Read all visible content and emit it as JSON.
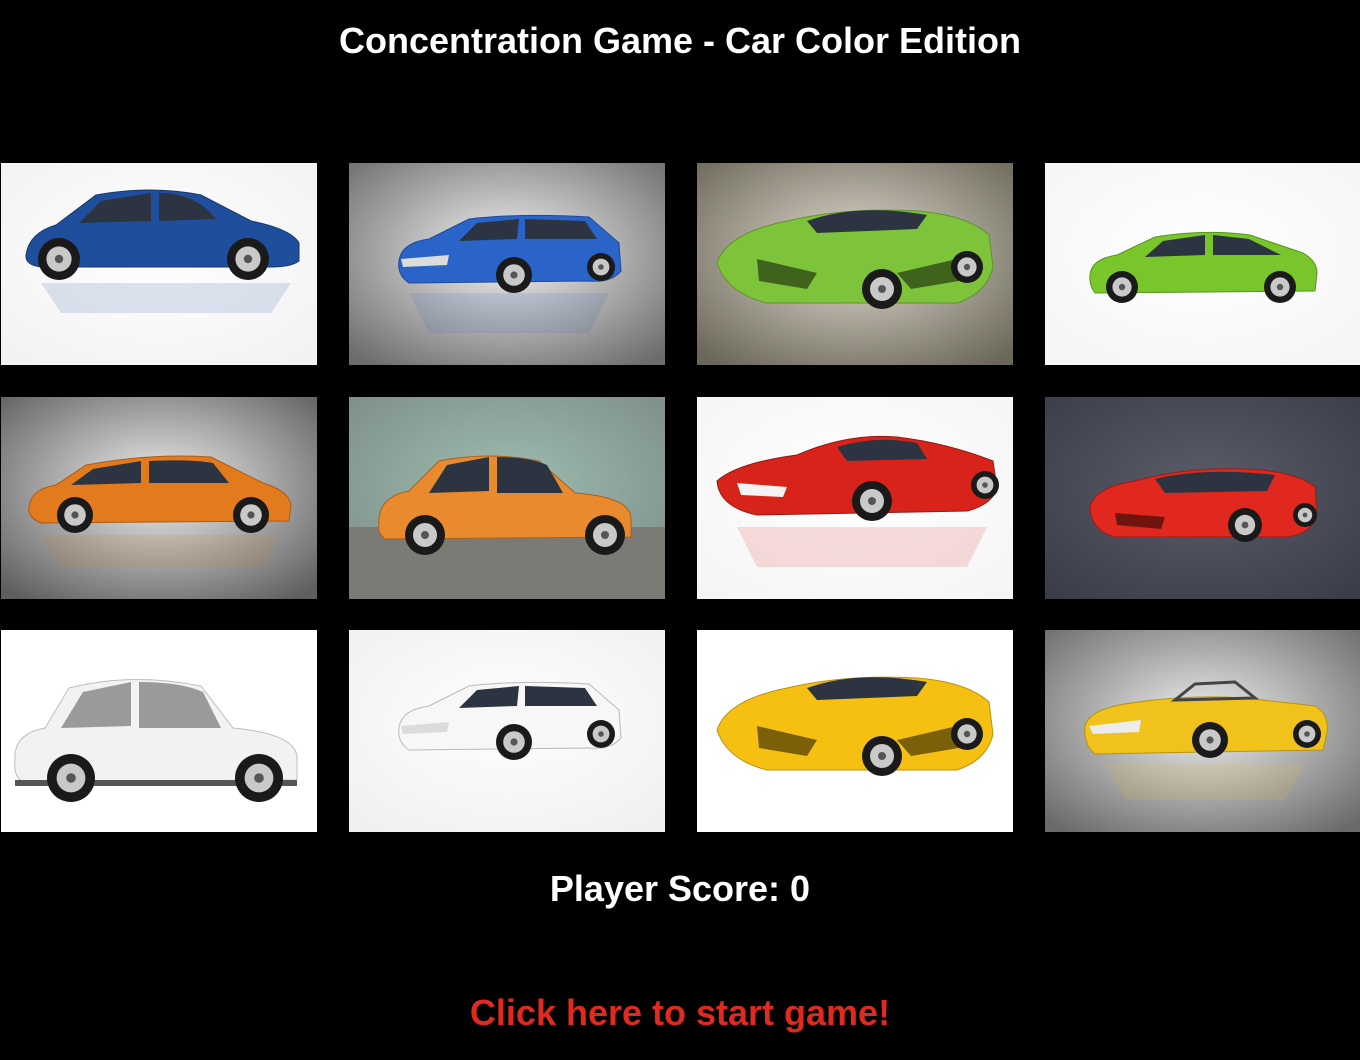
{
  "title": "Concentration Game - Car Color Edition",
  "score": {
    "label": "Player Score: ",
    "value": "0"
  },
  "start_link": "Click here to start game!",
  "colors": {
    "background": "#000000",
    "text": "#ffffff",
    "start_link": "#e0291f"
  },
  "cards": [
    {
      "name": "blue-hatchback",
      "car_color": "#1f4f9c",
      "bg": "#ffffff",
      "bg_edge": "#f2f2f2",
      "body": "hatch"
    },
    {
      "name": "blue-wagon",
      "car_color": "#2a64c8",
      "bg": "#f4f4f4",
      "bg_edge": "#6c6c6c",
      "body": "wagon"
    },
    {
      "name": "green-supercar",
      "car_color": "#7ec43a",
      "bg": "#e2ddd0",
      "bg_edge": "#6a6658",
      "body": "super"
    },
    {
      "name": "green-hybrid",
      "car_color": "#78c52c",
      "bg": "#ffffff",
      "bg_edge": "#f5f5f5",
      "body": "hybrid"
    },
    {
      "name": "orange-wagon",
      "car_color": "#e27a1e",
      "bg": "#f0f0f0",
      "bg_edge": "#5e5e5e",
      "body": "wagon2"
    },
    {
      "name": "orange-compact",
      "car_color": "#e98a2e",
      "bg": "#9fbdb2",
      "bg_edge": "#7d8e86",
      "body": "compact"
    },
    {
      "name": "red-sportscar",
      "car_color": "#d8231b",
      "bg": "#ffffff",
      "bg_edge": "#f5f5f5",
      "body": "sport"
    },
    {
      "name": "red-supercar",
      "car_color": "#e0281e",
      "bg": "#5a5d6a",
      "bg_edge": "#3b3d48",
      "body": "super2"
    },
    {
      "name": "white-compact",
      "car_color": "#f2f2f2",
      "bg": "#ffffff",
      "bg_edge": "#ffffff",
      "body": "compact2"
    },
    {
      "name": "white-wagon",
      "car_color": "#f7f7f7",
      "bg": "#ffffff",
      "bg_edge": "#f0f0f0",
      "body": "wagon"
    },
    {
      "name": "yellow-sportscar",
      "car_color": "#f6c012",
      "bg": "#ffffff",
      "bg_edge": "#ffffff",
      "body": "super"
    },
    {
      "name": "yellow-convertible",
      "car_color": "#f2c21c",
      "bg": "#f0f0f0",
      "bg_edge": "#6a6a6a",
      "body": "convert"
    }
  ]
}
